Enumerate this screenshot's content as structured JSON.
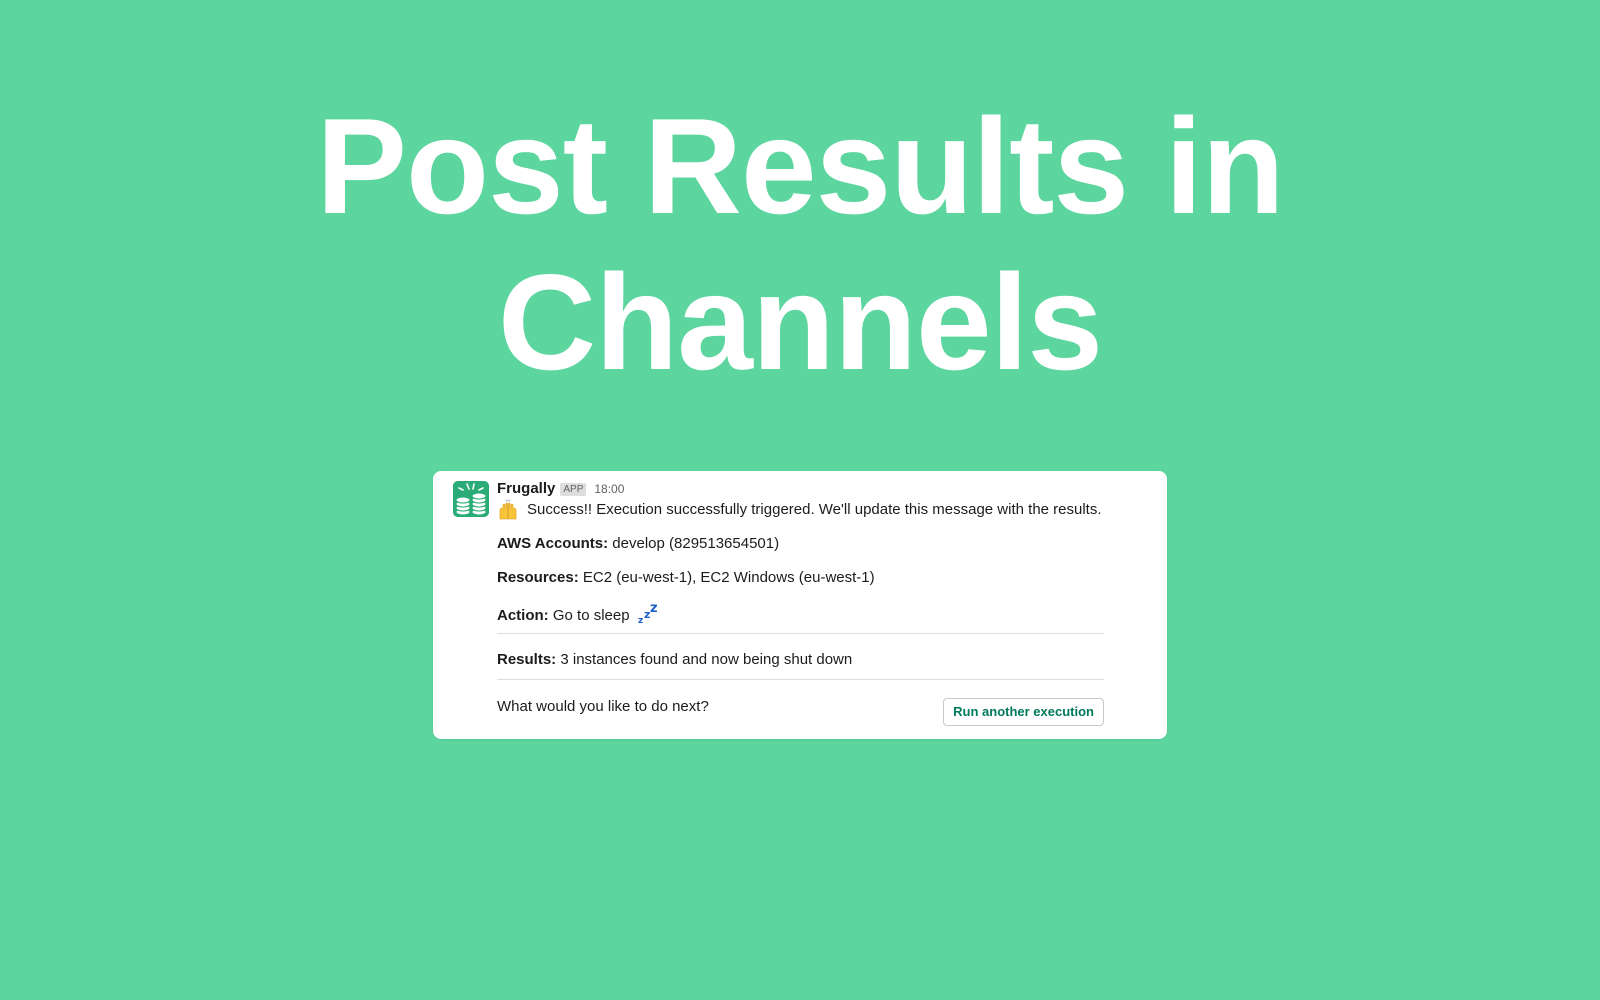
{
  "headline": {
    "line1": "Post Results in",
    "line2": "Channels"
  },
  "message": {
    "sender": "Frugally",
    "badge": "APP",
    "time": "18:00",
    "intro": "Success!! Execution successfully triggered. We'll update this message with the results.",
    "intro_emoji": "raised-hands-icon",
    "fields": {
      "accounts_label": "AWS Accounts:",
      "accounts_value": "develop (829513654501)",
      "resources_label": "Resources:",
      "resources_value": "EC2 (eu-west-1), EC2 Windows (eu-west-1)",
      "action_label": "Action:",
      "action_value": "Go to sleep",
      "action_emoji": "zzz-icon"
    },
    "results_label": "Results:",
    "results_value": "3 instances found and now being shut down",
    "next_prompt": "What would you like to do next?",
    "run_button": "Run another execution"
  },
  "colors": {
    "background": "#5dd59f",
    "headline": "#ffffff",
    "card": "#ffffff",
    "avatar": "#2bac76",
    "button_text": "#007a5a",
    "zzz": "#1d62c8"
  }
}
